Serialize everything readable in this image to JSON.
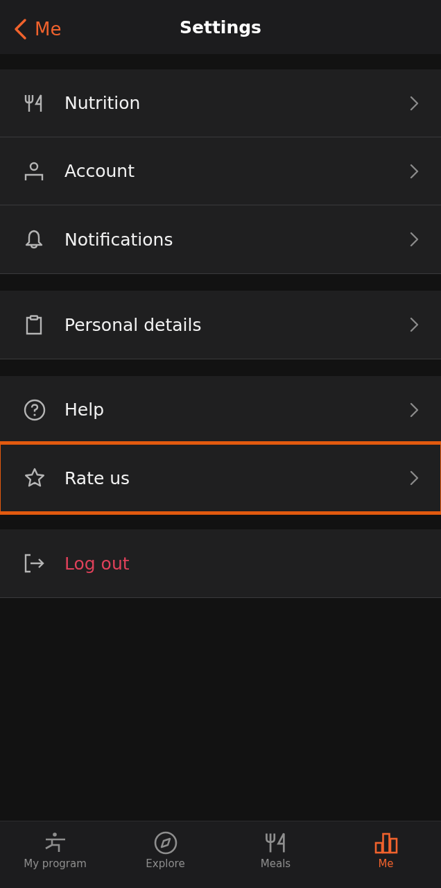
{
  "nav": {
    "back_label": "Me",
    "title": "Settings"
  },
  "groups": [
    {
      "items": [
        {
          "label": "Nutrition",
          "destructive": false,
          "highlighted": false
        },
        {
          "label": "Account",
          "destructive": false,
          "highlighted": false
        },
        {
          "label": "Notifications",
          "destructive": false,
          "highlighted": false
        }
      ]
    },
    {
      "items": [
        {
          "label": "Personal details",
          "destructive": false,
          "highlighted": false
        }
      ]
    },
    {
      "items": [
        {
          "label": "Help",
          "destructive": false,
          "highlighted": false
        },
        {
          "label": "Rate us",
          "destructive": false,
          "highlighted": true
        }
      ]
    },
    {
      "items": [
        {
          "label": "Log out",
          "destructive": true,
          "highlighted": false
        }
      ]
    }
  ],
  "tabs": [
    {
      "label": "My program",
      "selected": false
    },
    {
      "label": "Explore",
      "selected": false
    },
    {
      "label": "Meals",
      "selected": false
    },
    {
      "label": "Me",
      "selected": true
    }
  ]
}
